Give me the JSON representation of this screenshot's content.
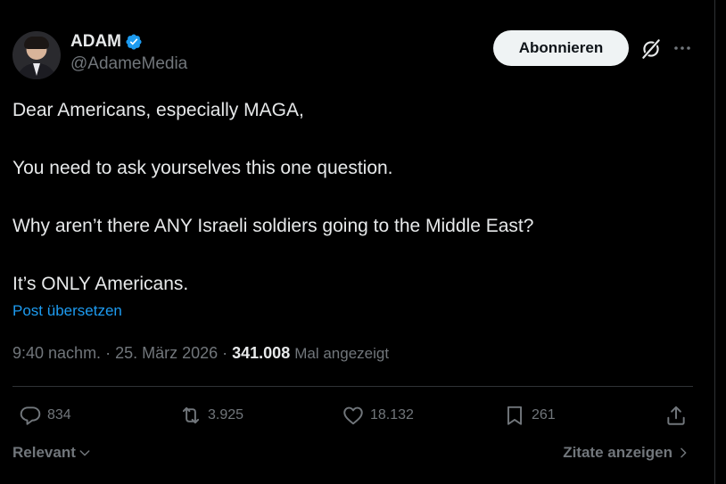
{
  "author": {
    "name": "ADAM",
    "handle": "@AdameMedia",
    "verified": true
  },
  "header": {
    "follow_label": "Abonnieren",
    "grok_icon": "grok-icon",
    "more_icon": "more-icon"
  },
  "post": {
    "paragraphs": [
      "Dear Americans, especially MAGA,",
      "You need to ask yourselves this one question.",
      "Why aren’t there ANY Israeli soldiers going to the Middle East?",
      "It’s ONLY Americans."
    ],
    "translate_label": "Post übersetzen"
  },
  "meta": {
    "time": "9:40 nachm.",
    "sep1": " · ",
    "date": "25. März 2026",
    "sep2": " · ",
    "views": "341.008",
    "views_label": "Mal angezeigt"
  },
  "actions": {
    "replies": "834",
    "reposts": "3.925",
    "likes": "18.132",
    "bookmarks": "261"
  },
  "footer": {
    "sort_label": "Relevant",
    "quotes_label": "Zitate anzeigen"
  },
  "colors": {
    "background": "#000000",
    "text": "#e7e9ea",
    "muted": "#71767b",
    "link": "#1d9bf0",
    "verified": "#1d9bf0",
    "divider": "#2f3336"
  }
}
